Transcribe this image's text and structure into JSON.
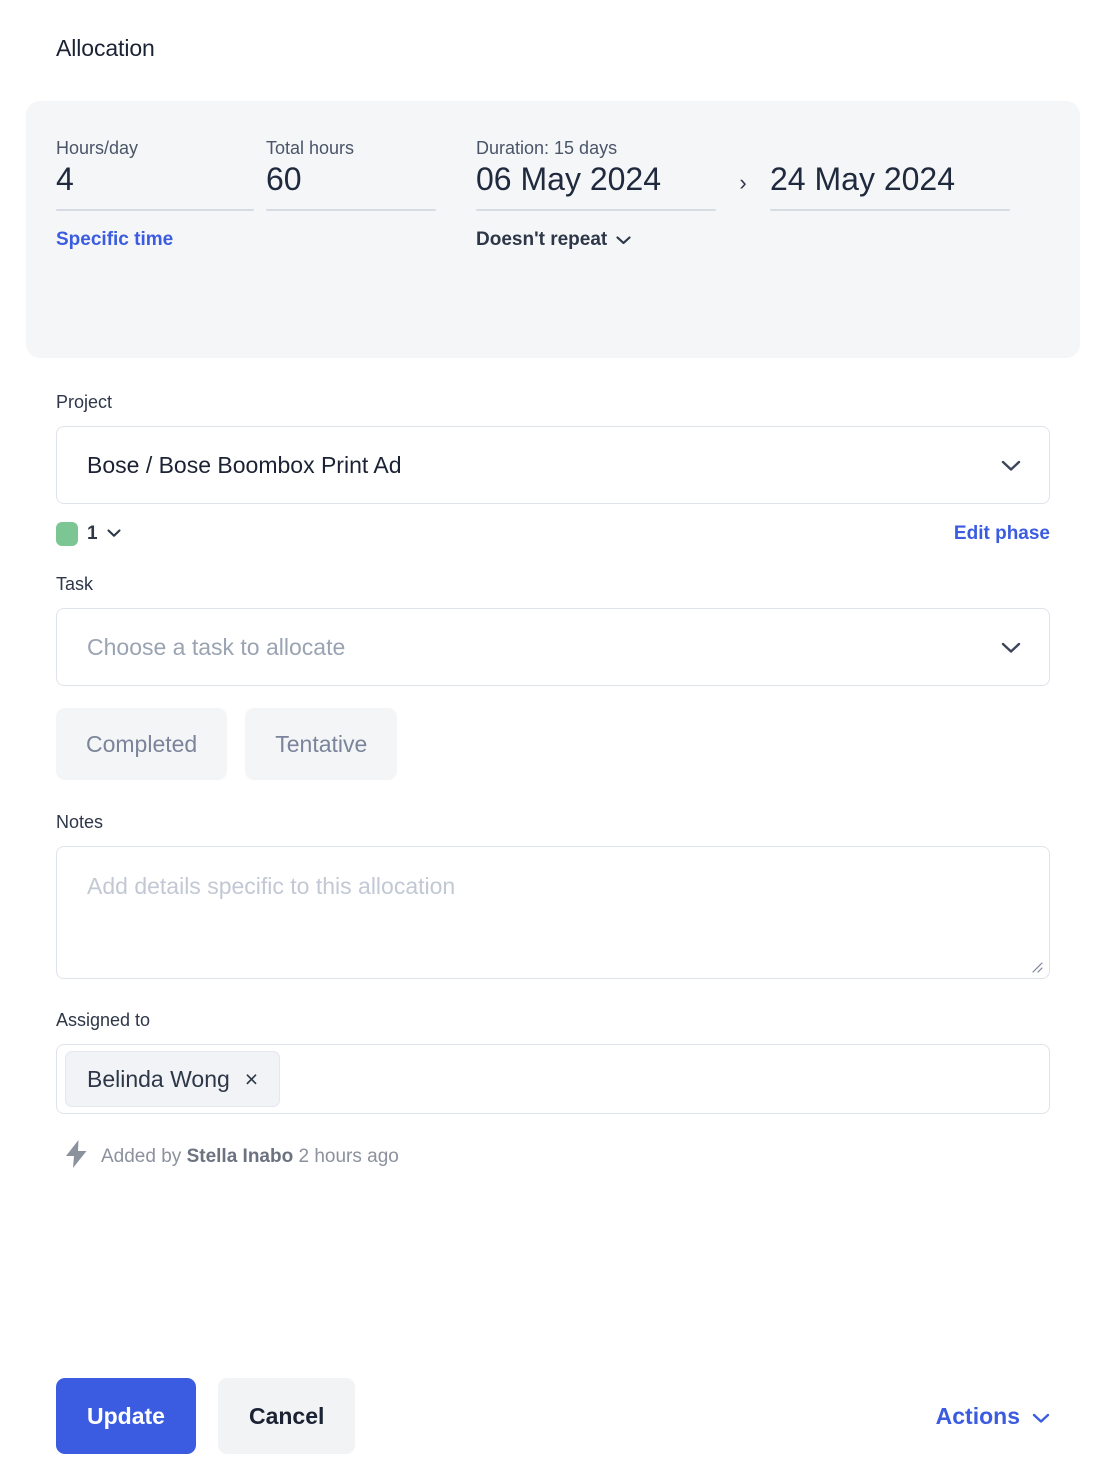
{
  "page_title": "Allocation",
  "summary": {
    "hours_per_day": {
      "label": "Hours/day",
      "value": "4"
    },
    "total_hours": {
      "label": "Total hours",
      "value": "60"
    },
    "duration": {
      "label": "Duration: 15 days"
    },
    "start_date": "06 May 2024",
    "date_separator": "›",
    "end_date": "24 May 2024",
    "specific_time_link": "Specific time",
    "repeat_label": "Doesn't repeat"
  },
  "project": {
    "label": "Project",
    "value": "Bose / Bose Boombox Print Ad",
    "phase_number": "1",
    "phase_color": "#7cc693",
    "edit_phase_link": "Edit phase"
  },
  "task": {
    "label": "Task",
    "placeholder": "Choose a task to allocate",
    "status_buttons": [
      {
        "label": "Completed"
      },
      {
        "label": "Tentative"
      }
    ]
  },
  "notes": {
    "label": "Notes",
    "placeholder": "Add details specific to this allocation",
    "value": ""
  },
  "assigned_to": {
    "label": "Assigned to",
    "people": [
      {
        "name": "Belinda Wong",
        "remove": "×"
      }
    ]
  },
  "meta": {
    "prefix": "Added by ",
    "author": "Stella Inabo",
    "suffix": " 2 hours ago"
  },
  "footer": {
    "update_label": "Update",
    "cancel_label": "Cancel",
    "actions_label": "Actions"
  },
  "colors": {
    "accent_blue": "#3b5ce0",
    "panel_bg": "#f5f6f8",
    "phase_green": "#7cc693",
    "text_dark": "#1b2233",
    "text_muted": "#7b849a"
  }
}
